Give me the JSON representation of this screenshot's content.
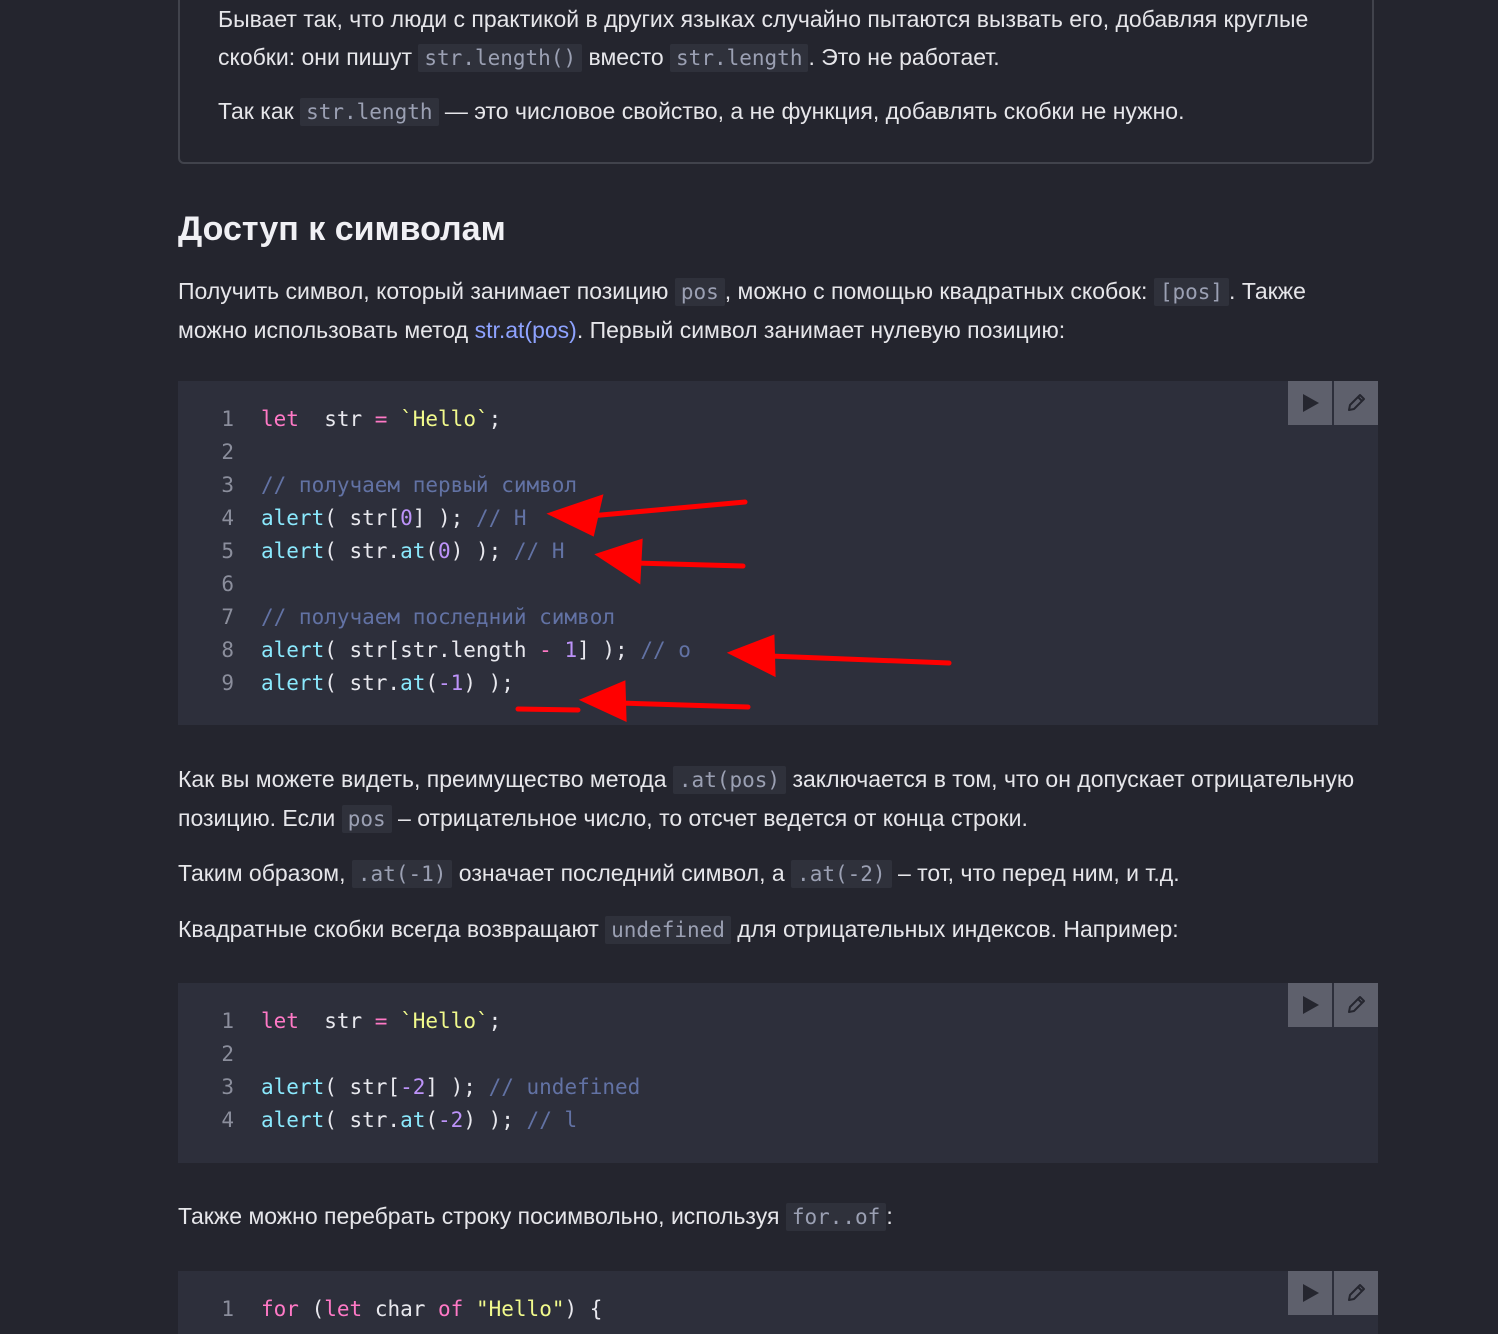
{
  "note": {
    "p1_a": "Бывает так, что люди с практикой в других языках случайно пытаются вызвать его, добавляя круглые скобки: они пишут ",
    "p1_code1": "str.length()",
    "p1_b": " вместо ",
    "p1_code2": "str.length",
    "p1_c": ". Это не работает.",
    "p2_a": "Так как ",
    "p2_code": "str.length",
    "p2_b": " — это числовое свойство, а не функция, добавлять скобки не нужно."
  },
  "section": {
    "title": "Доступ к символам",
    "intro_a": "Получить символ, который занимает позицию ",
    "intro_code1": "pos",
    "intro_b": ", можно с помощью квадратных скобок: ",
    "intro_code2": "[pos]",
    "intro_c": ". Также можно использовать метод ",
    "intro_link": "str.at(pos)",
    "intro_d": ". Первый символ занимает нулевую позицию:",
    "para2_a": "Как вы можете видеть, преимущество метода ",
    "para2_code1": ".at(pos)",
    "para2_b": " заключается в том, что он допускает отрицательную позицию. Если ",
    "para2_code2": "pos",
    "para2_c": " – отрицательное число, то отсчет ведется от конца строки.",
    "para3_a": "Таким образом, ",
    "para3_code1": ".at(-1)",
    "para3_b": " означает последний символ, а ",
    "para3_code2": ".at(-2)",
    "para3_c": " – тот, что перед ним, и т.д.",
    "para4_a": "Квадратные скобки всегда возвращают ",
    "para4_code": "undefined",
    "para4_b": " для отрицательных индексов. Например:",
    "para5_a": "Также можно перебрать строку посимвольно, используя ",
    "para5_code": "for..of",
    "para5_b": ":"
  },
  "code1": [
    {
      "n": "1",
      "tokens": [
        [
          "kw",
          "let"
        ],
        [
          "",
          "  str "
        ],
        [
          "op",
          "="
        ],
        [
          "",
          " "
        ],
        [
          "str",
          "`Hello`"
        ],
        [
          "",
          ";"
        ]
      ]
    },
    {
      "n": "2",
      "tokens": []
    },
    {
      "n": "3",
      "tokens": [
        [
          "cm",
          "// получаем первый символ"
        ]
      ]
    },
    {
      "n": "4",
      "tokens": [
        [
          "fn",
          "alert"
        ],
        [
          "",
          "( str["
        ],
        [
          "num",
          "0"
        ],
        [
          "",
          "] ); "
        ],
        [
          "cm",
          "// H"
        ]
      ]
    },
    {
      "n": "5",
      "tokens": [
        [
          "fn",
          "alert"
        ],
        [
          "",
          "( str."
        ],
        [
          "fn",
          "at"
        ],
        [
          "",
          "("
        ],
        [
          "num",
          "0"
        ],
        [
          "",
          ") ); "
        ],
        [
          "cm",
          "// H"
        ]
      ]
    },
    {
      "n": "6",
      "tokens": []
    },
    {
      "n": "7",
      "tokens": [
        [
          "cm",
          "// получаем последний символ"
        ]
      ]
    },
    {
      "n": "8",
      "tokens": [
        [
          "fn",
          "alert"
        ],
        [
          "",
          "( str[str.length "
        ],
        [
          "op",
          "-"
        ],
        [
          "",
          " "
        ],
        [
          "num",
          "1"
        ],
        [
          "",
          "] ); "
        ],
        [
          "cm",
          "// o"
        ]
      ]
    },
    {
      "n": "9",
      "tokens": [
        [
          "fn",
          "alert"
        ],
        [
          "",
          "( str."
        ],
        [
          "fn",
          "at"
        ],
        [
          "",
          "("
        ],
        [
          "num",
          "-1"
        ],
        [
          "",
          ") );"
        ]
      ]
    }
  ],
  "code2": [
    {
      "n": "1",
      "tokens": [
        [
          "kw",
          "let"
        ],
        [
          "",
          "  str "
        ],
        [
          "op",
          "="
        ],
        [
          "",
          " "
        ],
        [
          "str",
          "`Hello`"
        ],
        [
          "",
          ";"
        ]
      ]
    },
    {
      "n": "2",
      "tokens": []
    },
    {
      "n": "3",
      "tokens": [
        [
          "fn",
          "alert"
        ],
        [
          "",
          "( str["
        ],
        [
          "num",
          "-2"
        ],
        [
          "",
          "] ); "
        ],
        [
          "cm",
          "// undefined"
        ]
      ]
    },
    {
      "n": "4",
      "tokens": [
        [
          "fn",
          "alert"
        ],
        [
          "",
          "( str."
        ],
        [
          "fn",
          "at"
        ],
        [
          "",
          "("
        ],
        [
          "num",
          "-2"
        ],
        [
          "",
          ") ); "
        ],
        [
          "cm",
          "// l"
        ]
      ]
    }
  ],
  "code3": [
    {
      "n": "1",
      "tokens": [
        [
          "kw",
          "for"
        ],
        [
          "",
          " ("
        ],
        [
          "kw",
          "let"
        ],
        [
          "",
          " char "
        ],
        [
          "kw",
          "of"
        ],
        [
          "",
          " "
        ],
        [
          "str",
          "\"Hello\""
        ],
        [
          "",
          ") {"
        ]
      ]
    }
  ],
  "toolbar": {
    "run_icon": "play-icon",
    "edit_icon": "pencil-icon"
  },
  "colors": {
    "background": "#24252e",
    "code_bg": "#2d2f3b",
    "arrow": "#ff0000",
    "link": "#8ea3ff"
  }
}
